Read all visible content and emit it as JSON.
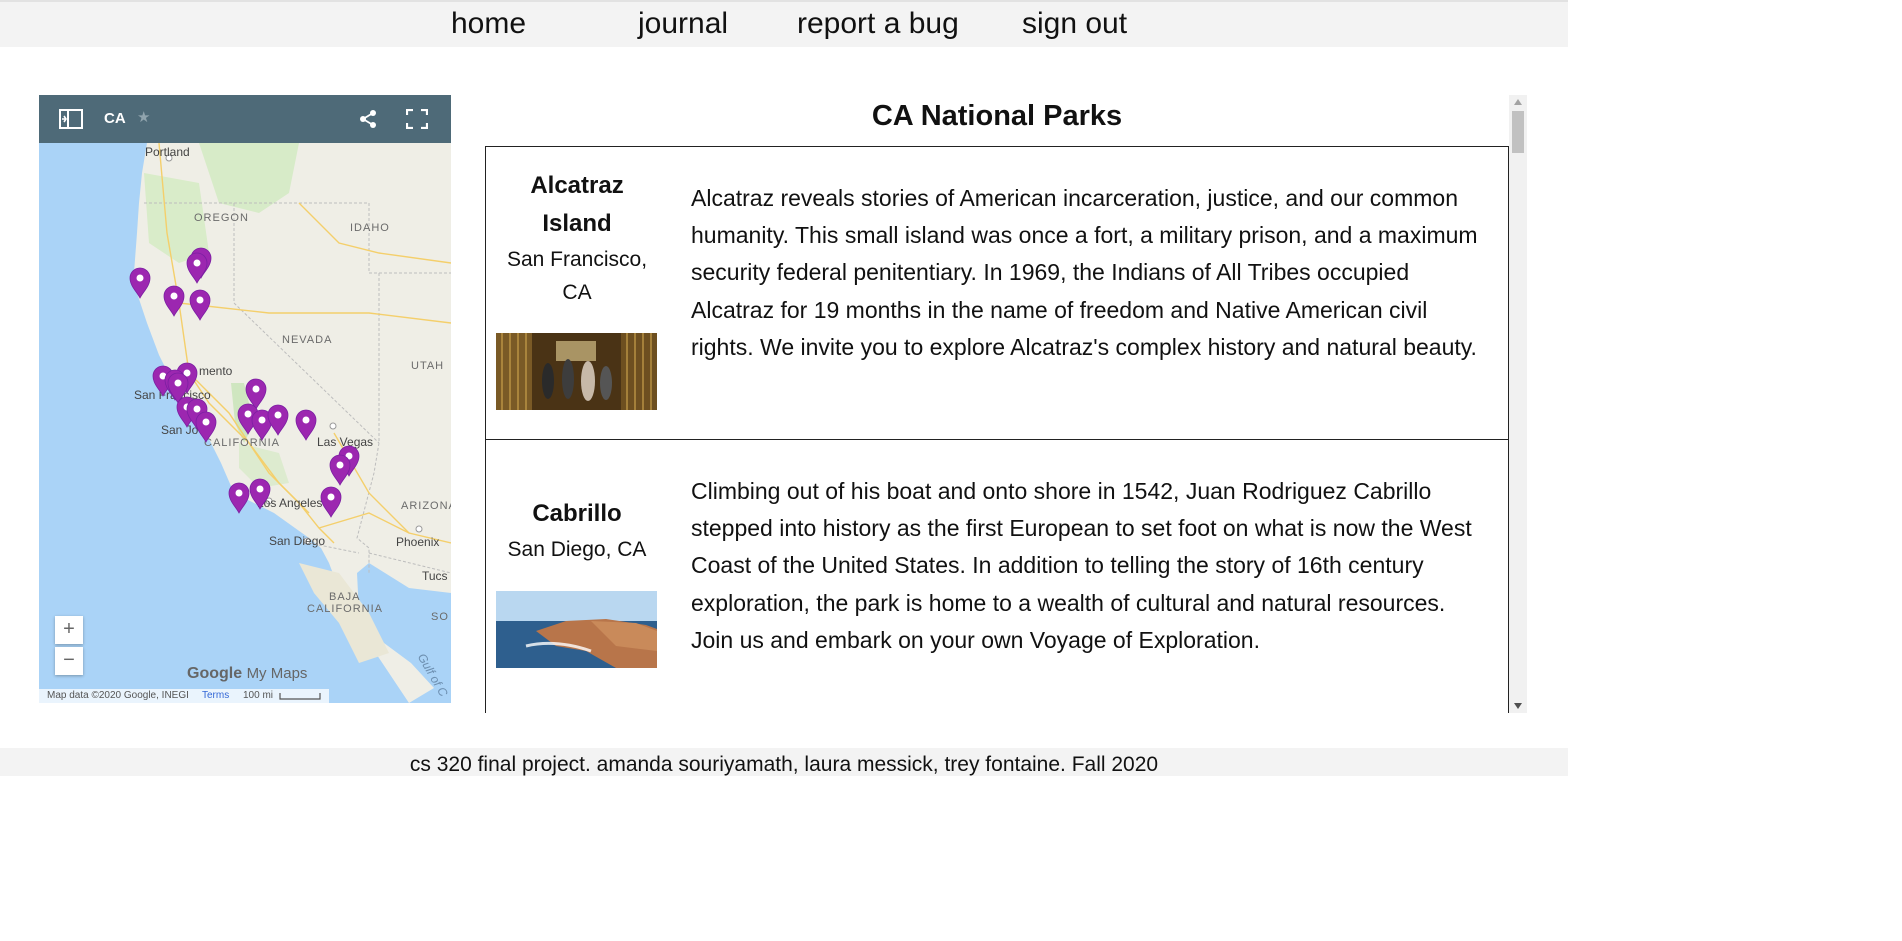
{
  "nav": {
    "home": "home",
    "journal": "journal",
    "report_bug": "report a bug",
    "sign_out": "sign out"
  },
  "map": {
    "title": "CA",
    "labels": {
      "portland": "Portland",
      "oregon": "OREGON",
      "idaho": "IDAHO",
      "nevada": "NEVADA",
      "utah": "UTAH",
      "sacramento": "mento",
      "san_francisco": "San Francisco",
      "san_jose": "San Jo",
      "california": "CALIFORNIA",
      "las_vegas": "Las Vegas",
      "arizona": "ARIZONA",
      "los_angeles": "Los Angeles",
      "san_diego": "San Diego",
      "phoenix": "Phoenix",
      "tucson": "Tucs",
      "baja": "BAJA",
      "baja_ca": "CALIFORNIA",
      "sonora": "SO",
      "gulf": "Gulf of C"
    },
    "zoom_in": "+",
    "zoom_out": "−",
    "brand": "Google",
    "brand_sub": "My Maps",
    "attribution": "Map data ©2020 Google, INEGI",
    "terms": "Terms",
    "scale": "100 mi",
    "marker_color": "#9c27b0"
  },
  "parks": {
    "title": "CA National Parks",
    "items": [
      {
        "name": "Alcatraz Island",
        "location": "San Francisco, CA",
        "description": "Alcatraz reveals stories of American incarceration, justice, and our common humanity. This small island was once a fort, a military prison, and a maximum security federal penitentiary. In 1969, the Indians of All Tribes occupied Alcatraz for 19 months in the name of freedom and Native American civil rights. We invite you to explore Alcatraz's complex history and natural beauty."
      },
      {
        "name": "Cabrillo",
        "location": "San Diego, CA",
        "description": "Climbing out of his boat and onto shore in 1542, Juan Rodriguez Cabrillo stepped into history as the first European to set foot on what is now the West Coast of the United States. In addition to telling the story of 16th century exploration, the park is home to a wealth of cultural and natural resources. Join us and embark on your own Voyage of Exploration."
      }
    ]
  },
  "footer": {
    "text": "cs 320 final project. amanda souriyamath, laura messick, trey fontaine. Fall 2020"
  }
}
